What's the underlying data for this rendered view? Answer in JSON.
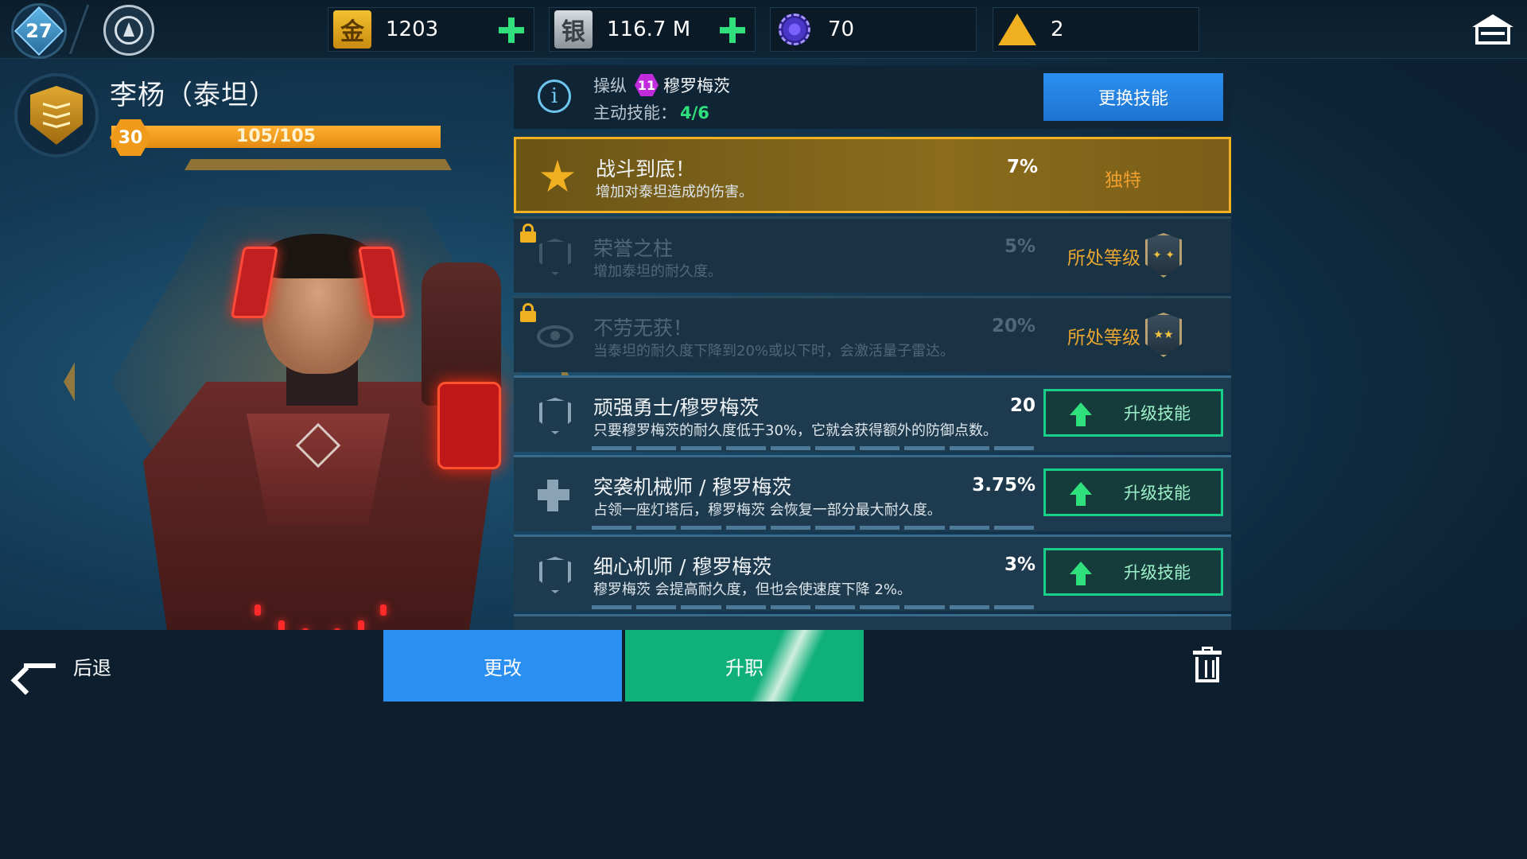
{
  "topbar": {
    "player_level": "27",
    "resources": [
      {
        "name": "gold",
        "icon_text": "金",
        "value": "1203",
        "has_plus": true
      },
      {
        "name": "silver",
        "icon_text": "银",
        "value": "116.7 M",
        "has_plus": true
      },
      {
        "name": "gear-currency",
        "value": "70",
        "has_plus": false
      },
      {
        "name": "triangle-currency",
        "value": "2",
        "has_plus": false
      }
    ]
  },
  "pilot": {
    "name": "李杨（泰坦）",
    "level": "30",
    "xp_text": "105/105",
    "xp_fraction": 1.0
  },
  "panel": {
    "control_label": "操纵",
    "control_level": "11",
    "control_target": "穆罗梅茨",
    "active_label": "主动技能：",
    "active_count": "4/6",
    "change_skill_label": "更换技能"
  },
  "skills": [
    {
      "title": "战斗到底！",
      "desc": "增加对泰坦造成的伤害。",
      "value": "7%",
      "tag": "独特",
      "state": "exclusive",
      "icon": "burst-up-icon"
    },
    {
      "title": "荣誉之柱",
      "desc": "增加泰坦的耐久度。",
      "value": "5%",
      "tag": "所处等级",
      "state": "locked",
      "icon": "shield-up-icon",
      "rank_stars": "✦ ✦"
    },
    {
      "title": "不劳无获！",
      "desc": "当泰坦的耐久度下降到20%或以下时，会激活量子雷达。",
      "value": "20%",
      "tag": "所处等级",
      "state": "locked",
      "icon": "eye-icon",
      "rank_stars": "★★"
    },
    {
      "title": "顽强勇士/穆罗梅茨",
      "desc": "只要穆罗梅茨的耐久度低于30%，它就会获得额外的防御点数。",
      "value": "20",
      "tag": "升级技能",
      "state": "upgradable",
      "icon": "fort-up-icon"
    },
    {
      "title": "突袭机械师 / 穆罗梅茨",
      "desc": "占领一座灯塔后，穆罗梅茨 会恢复一部分最大耐久度。",
      "value": "3.75%",
      "tag": "升级技能",
      "state": "upgradable",
      "icon": "repair-plus-icon"
    },
    {
      "title": "细心机师 / 穆罗梅茨",
      "desc": "穆罗梅茨 会提高耐久度，但也会使速度下降 2%。",
      "value": "3%",
      "tag": "升级技能",
      "state": "upgradable",
      "icon": "shield-up-icon"
    }
  ],
  "bottombar": {
    "back_label": "后退",
    "edit_label": "更改",
    "promote_label": "升职"
  },
  "colors": {
    "accent_blue": "#2a8ff0",
    "accent_green": "#10b07a",
    "gold": "#f0b020",
    "upgrade_border": "#18d08a"
  }
}
